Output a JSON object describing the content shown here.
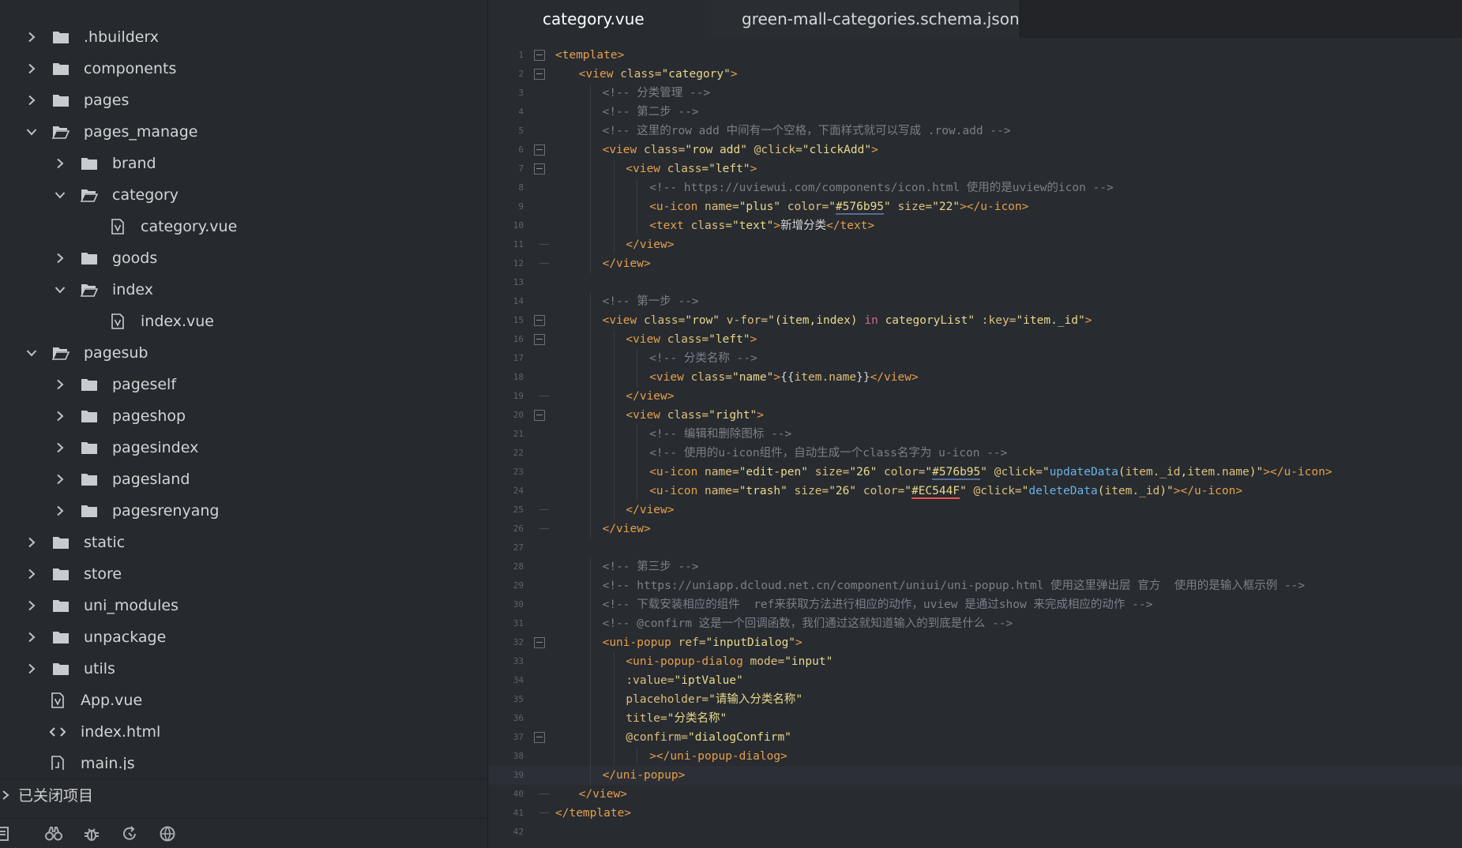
{
  "sidebar": {
    "tree": [
      {
        "label": ".hbuilderx",
        "type": "folder",
        "depth": 0,
        "expanded": false
      },
      {
        "label": "components",
        "type": "folder",
        "depth": 0,
        "expanded": false
      },
      {
        "label": "pages",
        "type": "folder",
        "depth": 0,
        "expanded": false
      },
      {
        "label": "pages_manage",
        "type": "folder",
        "depth": 0,
        "expanded": true
      },
      {
        "label": "brand",
        "type": "folder",
        "depth": 1,
        "expanded": false
      },
      {
        "label": "category",
        "type": "folder",
        "depth": 1,
        "expanded": true
      },
      {
        "label": "category.vue",
        "type": "vue",
        "depth": 2
      },
      {
        "label": "goods",
        "type": "folder",
        "depth": 1,
        "expanded": false
      },
      {
        "label": "index",
        "type": "folder",
        "depth": 1,
        "expanded": true
      },
      {
        "label": "index.vue",
        "type": "vue",
        "depth": 2
      },
      {
        "label": "pagesub",
        "type": "folder",
        "depth": 0,
        "expanded": true
      },
      {
        "label": "pageself",
        "type": "folder",
        "depth": 1,
        "expanded": false
      },
      {
        "label": "pageshop",
        "type": "folder",
        "depth": 1,
        "expanded": false
      },
      {
        "label": "pagesindex",
        "type": "folder",
        "depth": 1,
        "expanded": false
      },
      {
        "label": "pagesland",
        "type": "folder",
        "depth": 1,
        "expanded": false
      },
      {
        "label": "pagesrenyang",
        "type": "folder",
        "depth": 1,
        "expanded": false
      },
      {
        "label": "static",
        "type": "folder",
        "depth": 0,
        "expanded": false
      },
      {
        "label": "store",
        "type": "folder",
        "depth": 0,
        "expanded": false
      },
      {
        "label": "uni_modules",
        "type": "folder",
        "depth": 0,
        "expanded": false
      },
      {
        "label": "unpackage",
        "type": "folder",
        "depth": 0,
        "expanded": false
      },
      {
        "label": "utils",
        "type": "folder",
        "depth": 0,
        "expanded": false
      },
      {
        "label": "App.vue",
        "type": "vue",
        "depth": 0
      },
      {
        "label": "index.html",
        "type": "html",
        "depth": 0
      },
      {
        "label": "main.js",
        "type": "js",
        "depth": 0
      }
    ],
    "closed_projects_label": "已关闭项目",
    "toolbar": [
      "project-manager-icon",
      "search-binoculars-icon",
      "debug-bug-icon",
      "sync-icon",
      "browser-icon"
    ]
  },
  "editor": {
    "tabs": [
      {
        "label": "category.vue",
        "active": true
      },
      {
        "label": "green-mall-categories.schema.json",
        "active": false
      }
    ],
    "active_line": 39,
    "lines": [
      {
        "n": "1",
        "indent": 0,
        "fold": "open",
        "tokens": [
          [
            "tag",
            "<template>"
          ]
        ]
      },
      {
        "n": "2",
        "indent": 1,
        "fold": "open",
        "tokens": [
          [
            "tag",
            "<view "
          ],
          [
            "attr",
            "class="
          ],
          [
            "str",
            "\"category\""
          ],
          [
            "tag",
            ">"
          ]
        ]
      },
      {
        "n": "3",
        "indent": 2,
        "tokens": [
          [
            "com",
            "<!-- 分类管理 -->"
          ]
        ]
      },
      {
        "n": "4",
        "indent": 2,
        "tokens": [
          [
            "com",
            "<!-- 第二步 -->"
          ]
        ]
      },
      {
        "n": "5",
        "indent": 2,
        "tokens": [
          [
            "com",
            "<!-- 这里的row add 中间有一个空格，下面样式就可以写成 .row.add -->"
          ]
        ]
      },
      {
        "n": "6",
        "indent": 2,
        "fold": "open",
        "tokens": [
          [
            "tag",
            "<view "
          ],
          [
            "attr",
            "class="
          ],
          [
            "str",
            "\"row add\" "
          ],
          [
            "attr",
            "@click="
          ],
          [
            "str",
            "\"clickAdd\""
          ],
          [
            "tag",
            ">"
          ]
        ]
      },
      {
        "n": "7",
        "indent": 3,
        "fold": "open",
        "tokens": [
          [
            "tag",
            "<view "
          ],
          [
            "attr",
            "class="
          ],
          [
            "str",
            "\"left\""
          ],
          [
            "tag",
            ">"
          ]
        ]
      },
      {
        "n": "8",
        "indent": 4,
        "tokens": [
          [
            "com",
            "<!-- https://uviewui.com/components/icon.html 使用的是uview的icon -->"
          ]
        ]
      },
      {
        "n": "9",
        "indent": 4,
        "tokens": [
          [
            "tag",
            "<u-icon "
          ],
          [
            "attr",
            "name="
          ],
          [
            "str",
            "\"plus\" "
          ],
          [
            "attr",
            "color="
          ],
          [
            "str",
            "\""
          ],
          [
            "ulblue",
            "#576b95"
          ],
          [
            "str",
            "\" "
          ],
          [
            "attr",
            "size="
          ],
          [
            "str",
            "\"22\""
          ],
          [
            "tag",
            "></u-icon>"
          ]
        ]
      },
      {
        "n": "10",
        "indent": 4,
        "tokens": [
          [
            "tag",
            "<text "
          ],
          [
            "attr",
            "class="
          ],
          [
            "str",
            "\"text\""
          ],
          [
            "tag",
            ">"
          ],
          [
            "plain",
            "新增分类"
          ],
          [
            "tag",
            "</text>"
          ]
        ]
      },
      {
        "n": "11",
        "indent": 3,
        "fold": "end",
        "tokens": [
          [
            "tag",
            "</view>"
          ]
        ]
      },
      {
        "n": "12",
        "indent": 2,
        "fold": "end",
        "tokens": [
          [
            "tag",
            "</view>"
          ]
        ]
      },
      {
        "n": "13",
        "indent": 0,
        "tokens": []
      },
      {
        "n": "14",
        "indent": 2,
        "tokens": [
          [
            "com",
            "<!-- 第一步 -->"
          ]
        ]
      },
      {
        "n": "15",
        "indent": 2,
        "fold": "open",
        "tokens": [
          [
            "tag",
            "<view "
          ],
          [
            "attr",
            "class="
          ],
          [
            "str",
            "\"row\" "
          ],
          [
            "attr",
            "v-for="
          ],
          [
            "str",
            "\"(item,index) "
          ],
          [
            "kw",
            "in"
          ],
          [
            "str",
            " categoryList\" "
          ],
          [
            "attr",
            ":key="
          ],
          [
            "str",
            "\"item._id\""
          ],
          [
            "tag",
            ">"
          ]
        ]
      },
      {
        "n": "16",
        "indent": 3,
        "fold": "open",
        "tokens": [
          [
            "tag",
            "<view "
          ],
          [
            "attr",
            "class="
          ],
          [
            "str",
            "\"left\""
          ],
          [
            "tag",
            ">"
          ]
        ]
      },
      {
        "n": "17",
        "indent": 4,
        "tokens": [
          [
            "com",
            "<!-- 分类名称 -->"
          ]
        ]
      },
      {
        "n": "18",
        "indent": 4,
        "tokens": [
          [
            "tag",
            "<view "
          ],
          [
            "attr",
            "class="
          ],
          [
            "str",
            "\"name\""
          ],
          [
            "tag",
            ">"
          ],
          [
            "plain",
            "{{"
          ],
          [
            "attr",
            "item.name"
          ],
          [
            "plain",
            "}}"
          ],
          [
            "tag",
            "</view>"
          ]
        ]
      },
      {
        "n": "19",
        "indent": 3,
        "fold": "end",
        "tokens": [
          [
            "tag",
            "</view>"
          ]
        ]
      },
      {
        "n": "20",
        "indent": 3,
        "fold": "open",
        "tokens": [
          [
            "tag",
            "<view "
          ],
          [
            "attr",
            "class="
          ],
          [
            "str",
            "\"right\""
          ],
          [
            "tag",
            ">"
          ]
        ]
      },
      {
        "n": "21",
        "indent": 4,
        "tokens": [
          [
            "com",
            "<!-- 编辑和删除图标 -->"
          ]
        ]
      },
      {
        "n": "22",
        "indent": 4,
        "tokens": [
          [
            "com",
            "<!-- 使用的u-icon组件，自动生成一个class名字为 u-icon -->"
          ]
        ]
      },
      {
        "n": "23",
        "indent": 4,
        "tokens": [
          [
            "tag",
            "<u-icon "
          ],
          [
            "attr",
            "name="
          ],
          [
            "str",
            "\"edit-pen\" "
          ],
          [
            "attr",
            "size="
          ],
          [
            "str",
            "\"26\" "
          ],
          [
            "attr",
            "color="
          ],
          [
            "str",
            "\""
          ],
          [
            "ulblue",
            "#576b95"
          ],
          [
            "str",
            "\" "
          ],
          [
            "attr",
            "@click="
          ],
          [
            "str",
            "\""
          ],
          [
            "fn",
            "updateData"
          ],
          [
            "str",
            "("
          ],
          [
            "attr",
            "item._id"
          ],
          [
            "str",
            ","
          ],
          [
            "attr",
            "item.name"
          ],
          [
            "str",
            ")\""
          ],
          [
            "tag",
            "></u-icon>"
          ]
        ]
      },
      {
        "n": "24",
        "indent": 4,
        "tokens": [
          [
            "tag",
            "<u-icon "
          ],
          [
            "attr",
            "name="
          ],
          [
            "str",
            "\"trash\" "
          ],
          [
            "attr",
            "size="
          ],
          [
            "str",
            "\"26\" "
          ],
          [
            "attr",
            "color="
          ],
          [
            "str",
            "\""
          ],
          [
            "ulred",
            "#EC544F"
          ],
          [
            "str",
            "\" "
          ],
          [
            "attr",
            "@click="
          ],
          [
            "str",
            "\""
          ],
          [
            "fn",
            "deleteData"
          ],
          [
            "str",
            "("
          ],
          [
            "attr",
            "item._id"
          ],
          [
            "str",
            ")\""
          ],
          [
            "tag",
            "></u-icon>"
          ]
        ]
      },
      {
        "n": "25",
        "indent": 3,
        "fold": "end",
        "tokens": [
          [
            "tag",
            "</view>"
          ]
        ]
      },
      {
        "n": "26",
        "indent": 2,
        "fold": "end",
        "tokens": [
          [
            "tag",
            "</view>"
          ]
        ]
      },
      {
        "n": "27",
        "indent": 0,
        "tokens": []
      },
      {
        "n": "28",
        "indent": 2,
        "tokens": [
          [
            "com",
            "<!-- 第三步 -->"
          ]
        ]
      },
      {
        "n": "29",
        "indent": 2,
        "tokens": [
          [
            "com",
            "<!-- https://uniapp.dcloud.net.cn/component/uniui/uni-popup.html 使用这里弹出层 官方  使用的是输入框示例 -->"
          ]
        ]
      },
      {
        "n": "30",
        "indent": 2,
        "tokens": [
          [
            "com",
            "<!-- 下载安装相应的组件  ref来获取方法进行相应的动作，uview 是通过show 来完成相应的动作 -->"
          ]
        ]
      },
      {
        "n": "31",
        "indent": 2,
        "tokens": [
          [
            "com",
            "<!-- @confirm 这是一个回调函数，我们通过这就知道输入的到底是什么 -->"
          ]
        ]
      },
      {
        "n": "32",
        "indent": 2,
        "fold": "open",
        "tokens": [
          [
            "tag",
            "<uni-popup "
          ],
          [
            "attr",
            "ref="
          ],
          [
            "str",
            "\"inputDialog\""
          ],
          [
            "tag",
            ">"
          ]
        ]
      },
      {
        "n": "33",
        "indent": 3,
        "tokens": [
          [
            "tag",
            "<uni-popup-dialog "
          ],
          [
            "attr",
            "mode="
          ],
          [
            "str",
            "\"input\""
          ]
        ]
      },
      {
        "n": "34",
        "indent": 3,
        "tokens": [
          [
            "attr",
            ":value="
          ],
          [
            "str",
            "\"iptValue\""
          ]
        ]
      },
      {
        "n": "35",
        "indent": 3,
        "tokens": [
          [
            "attr",
            "placeholder="
          ],
          [
            "str",
            "\"请输入分类名称\""
          ]
        ]
      },
      {
        "n": "36",
        "indent": 3,
        "tokens": [
          [
            "attr",
            "title="
          ],
          [
            "str",
            "\"分类名称\""
          ]
        ]
      },
      {
        "n": "37",
        "indent": 3,
        "fold": "open",
        "tokens": [
          [
            "attr",
            "@confirm="
          ],
          [
            "str",
            "\"dialogConfirm\""
          ]
        ]
      },
      {
        "n": "38",
        "indent": 4,
        "tokens": [
          [
            "tag",
            "></uni-popup-dialog>"
          ]
        ]
      },
      {
        "n": "39",
        "indent": 2,
        "tokens": [
          [
            "tag",
            "</uni-popup>"
          ]
        ]
      },
      {
        "n": "40",
        "indent": 1,
        "fold": "end",
        "tokens": [
          [
            "tag",
            "</view>"
          ]
        ]
      },
      {
        "n": "41",
        "indent": 0,
        "fold": "end",
        "tokens": [
          [
            "tag",
            "</template>"
          ]
        ]
      },
      {
        "n": "42",
        "indent": 0,
        "tokens": []
      }
    ]
  },
  "colors": {
    "accent_blue": "#576b95",
    "accent_red": "#EC544F"
  }
}
